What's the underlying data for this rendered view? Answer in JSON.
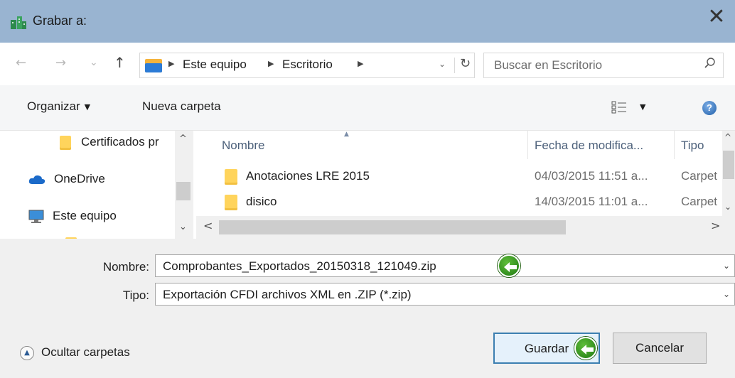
{
  "window": {
    "title": "Grabar a:",
    "close_glyph": "✕"
  },
  "nav": {
    "back_glyph": "←",
    "forward_glyph": "→",
    "recent_glyph": "⌄",
    "up_glyph": "↑",
    "breadcrumb": [
      "Este equipo",
      "Escritorio"
    ],
    "refresh_glyph": "↻",
    "search_placeholder": "Buscar en Escritorio"
  },
  "toolbar": {
    "organize_label": "Organizar",
    "new_folder_label": "Nueva carpeta",
    "help_glyph": "?"
  },
  "tree": [
    {
      "label": "Certificados pr",
      "icon": "folder-icon"
    },
    {
      "label": "OneDrive",
      "icon": "cloud-icon"
    },
    {
      "label": "Este equipo",
      "icon": "computer-icon"
    }
  ],
  "files": {
    "columns": {
      "name": "Nombre",
      "date": "Fecha de modifica...",
      "type": "Tipo"
    },
    "rows": [
      {
        "name": "Anotaciones LRE 2015",
        "date": "04/03/2015 11:51 a...",
        "type": "Carpet"
      },
      {
        "name": "disico",
        "date": "14/03/2015 11:01 a...",
        "type": "Carpet"
      }
    ]
  },
  "form": {
    "name_label": "Nombre:",
    "name_value": "Comprobantes_Exportados_20150318_121049.zip",
    "type_label": "Tipo:",
    "type_value": "Exportación CFDI archivos XML en .ZIP (*.zip)"
  },
  "footer": {
    "hide_folders_label": "Ocultar carpetas",
    "save_label": "Guardar",
    "cancel_label": "Cancelar"
  },
  "colors": {
    "titlebar": "#99b4d1",
    "folder": "#ffd45c",
    "accent": "#3c7fb1",
    "badge_green": "#2f9a1e"
  }
}
